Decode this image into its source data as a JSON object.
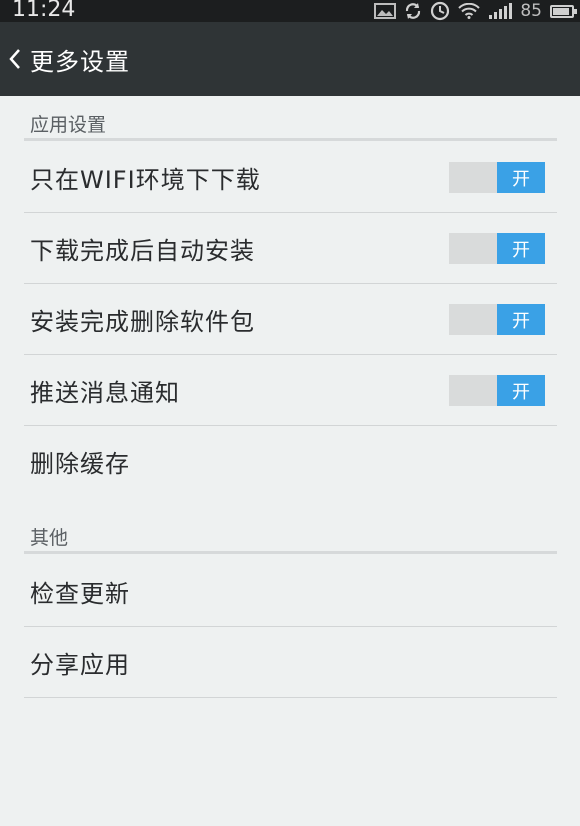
{
  "status_bar": {
    "time": "11:24",
    "battery": "85",
    "icons": [
      "image-icon",
      "sync-icon",
      "alarm-icon",
      "wifi-icon",
      "signal-icon",
      "battery-icon"
    ]
  },
  "app_bar": {
    "back_icon": "chevron-left-icon",
    "title": "更多设置"
  },
  "sections": [
    {
      "header": "应用设置",
      "items": [
        {
          "label": "只在WIFI环境下下载",
          "toggle": "开",
          "on": true
        },
        {
          "label": "下载完成后自动安装",
          "toggle": "开",
          "on": true
        },
        {
          "label": "安装完成删除软件包",
          "toggle": "开",
          "on": true
        },
        {
          "label": "推送消息通知",
          "toggle": "开",
          "on": true
        },
        {
          "label": "删除缓存"
        }
      ]
    },
    {
      "header": "其他",
      "items": [
        {
          "label": "检查更新"
        },
        {
          "label": "分享应用"
        }
      ]
    }
  ],
  "colors": {
    "toggle_on": "#3aa1e6",
    "app_bar": "#2f3436",
    "background": "#eef1f1"
  }
}
